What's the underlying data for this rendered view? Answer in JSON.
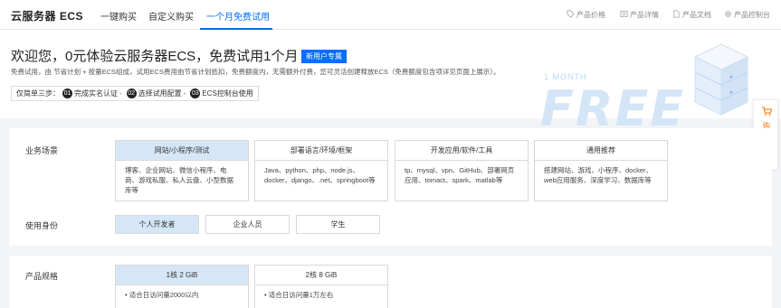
{
  "nav": {
    "brand": "云服务器 ECS",
    "tabs": [
      {
        "label": "一键购买"
      },
      {
        "label": "自定义购买"
      },
      {
        "label": "一个月免费试用"
      }
    ],
    "links": [
      {
        "label": "产品价格",
        "icon": "price-tag-icon"
      },
      {
        "label": "产品详情",
        "icon": "detail-icon"
      },
      {
        "label": "产品文档",
        "icon": "document-icon"
      },
      {
        "label": "产品控制台",
        "icon": "gear-icon"
      }
    ]
  },
  "hero": {
    "title": "欢迎您，0元体验云服务器ECS，免费试用1个月",
    "badge": "新用户专属",
    "desc": "免费试用，由 节省计划 + 按量ECS组成，试用ECS费用由节省计划抵扣，免费额度内，无需额外付费，您可灵活创建释放ECS（免费额度包含项详见页面上展示）。",
    "steps_label": "仅简单三步：",
    "steps": [
      {
        "num": "01",
        "label": "完成实名认证"
      },
      {
        "num": "02",
        "label": "选择试用配置"
      },
      {
        "num": "03",
        "label": "ECS控制台使用"
      }
    ],
    "banner_small": "1 MONTH",
    "banner_big": "FREE"
  },
  "cart": {
    "label": "购物车",
    "count": "0"
  },
  "scenario": {
    "label": "业务场景",
    "cards": [
      {
        "title": "网站/小程序/测试",
        "body": "博客、企业网站、微信小程序、电商、游戏私服、私人云盘、小型数据库等",
        "selected": true
      },
      {
        "title": "部署语言/环境/框架",
        "body": "Java、python、php、node.js、docker、django、.net、springboot等",
        "selected": false
      },
      {
        "title": "开发应用/软件/工具",
        "body": "tp、mysql、vpn、GitHub、部署网页应用、tomact、spark、matlab等",
        "selected": false
      },
      {
        "title": "通用推荐",
        "body": "搭建网站、游戏、小程序、docker、web应用服务、深度学习、数据库等",
        "selected": false
      }
    ]
  },
  "identity": {
    "label": "使用身份",
    "options": [
      {
        "label": "个人开发者",
        "selected": true
      },
      {
        "label": "企业人员",
        "selected": false
      },
      {
        "label": "学生",
        "selected": false
      }
    ]
  },
  "spec": {
    "label": "产品规格",
    "cards": [
      {
        "title": "1核 2 GiB",
        "body": "• 适合日访问量2000以内",
        "selected": true
      },
      {
        "title": "2核 8 GiB",
        "body": "• 适合日访问量1万左右",
        "selected": false
      }
    ]
  },
  "colors": {
    "accent": "#006eff",
    "selected_bg": "#d5e7f7",
    "cart": "#ff7200"
  }
}
